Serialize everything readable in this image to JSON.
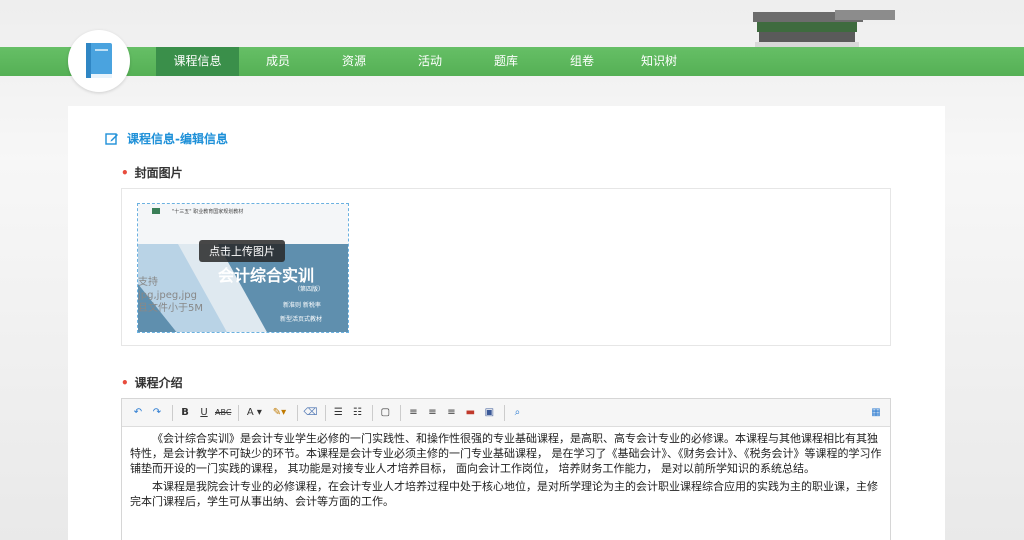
{
  "nav": {
    "items": [
      {
        "label": "课程信息",
        "active": true
      },
      {
        "label": "成员"
      },
      {
        "label": "资源"
      },
      {
        "label": "活动"
      },
      {
        "label": "题库"
      },
      {
        "label": "组卷"
      },
      {
        "label": "知识树"
      }
    ]
  },
  "page": {
    "title": "课程信息-编辑信息"
  },
  "cover": {
    "label": "封面图片",
    "upload_tip": "点击上传图片",
    "hint_line1": "支持jpg,jpeg,jpg",
    "hint_line2": "且文件小于5M",
    "book_series": "\"十三五\" 职业教育国家规划教材",
    "book_title": "会计综合实训",
    "book_edition": "（第四版）",
    "book_authors": "新准则 新税率",
    "book_type": "新型活页式教材"
  },
  "intro": {
    "label": "课程介绍",
    "paragraph1": "《会计综合实训》是会计专业学生必修的一门实践性、和操作性很强的专业基础课程，是高职、高专会计专业的必修课。本课程与其他课程相比有其独特性，是会计教学不可缺少的环节。本课程是会计专业必须主修的一门专业基础课程， 是在学习了《基础会计》、《财务会计》、《税务会计》等课程的学习作铺垫而开设的一门实践的课程， 其功能是对接专业人才培养目标， 面向会计工作岗位， 培养财务工作能力， 是对以前所学知识的系统总结。",
    "paragraph2": "本课程是我院会计专业的必修课程，在会计专业人才培养过程中处于核心地位，是对所学理论为主的会计职业课程综合应用的实践为主的职业课，主修完本门课程后，学生可从事出纳、会计等方面的工作。"
  },
  "colors": {
    "nav_green": "#5cb85c",
    "nav_active": "#3a8f4a",
    "title_blue": "#1e90d8",
    "required_red": "#e84c3d"
  }
}
